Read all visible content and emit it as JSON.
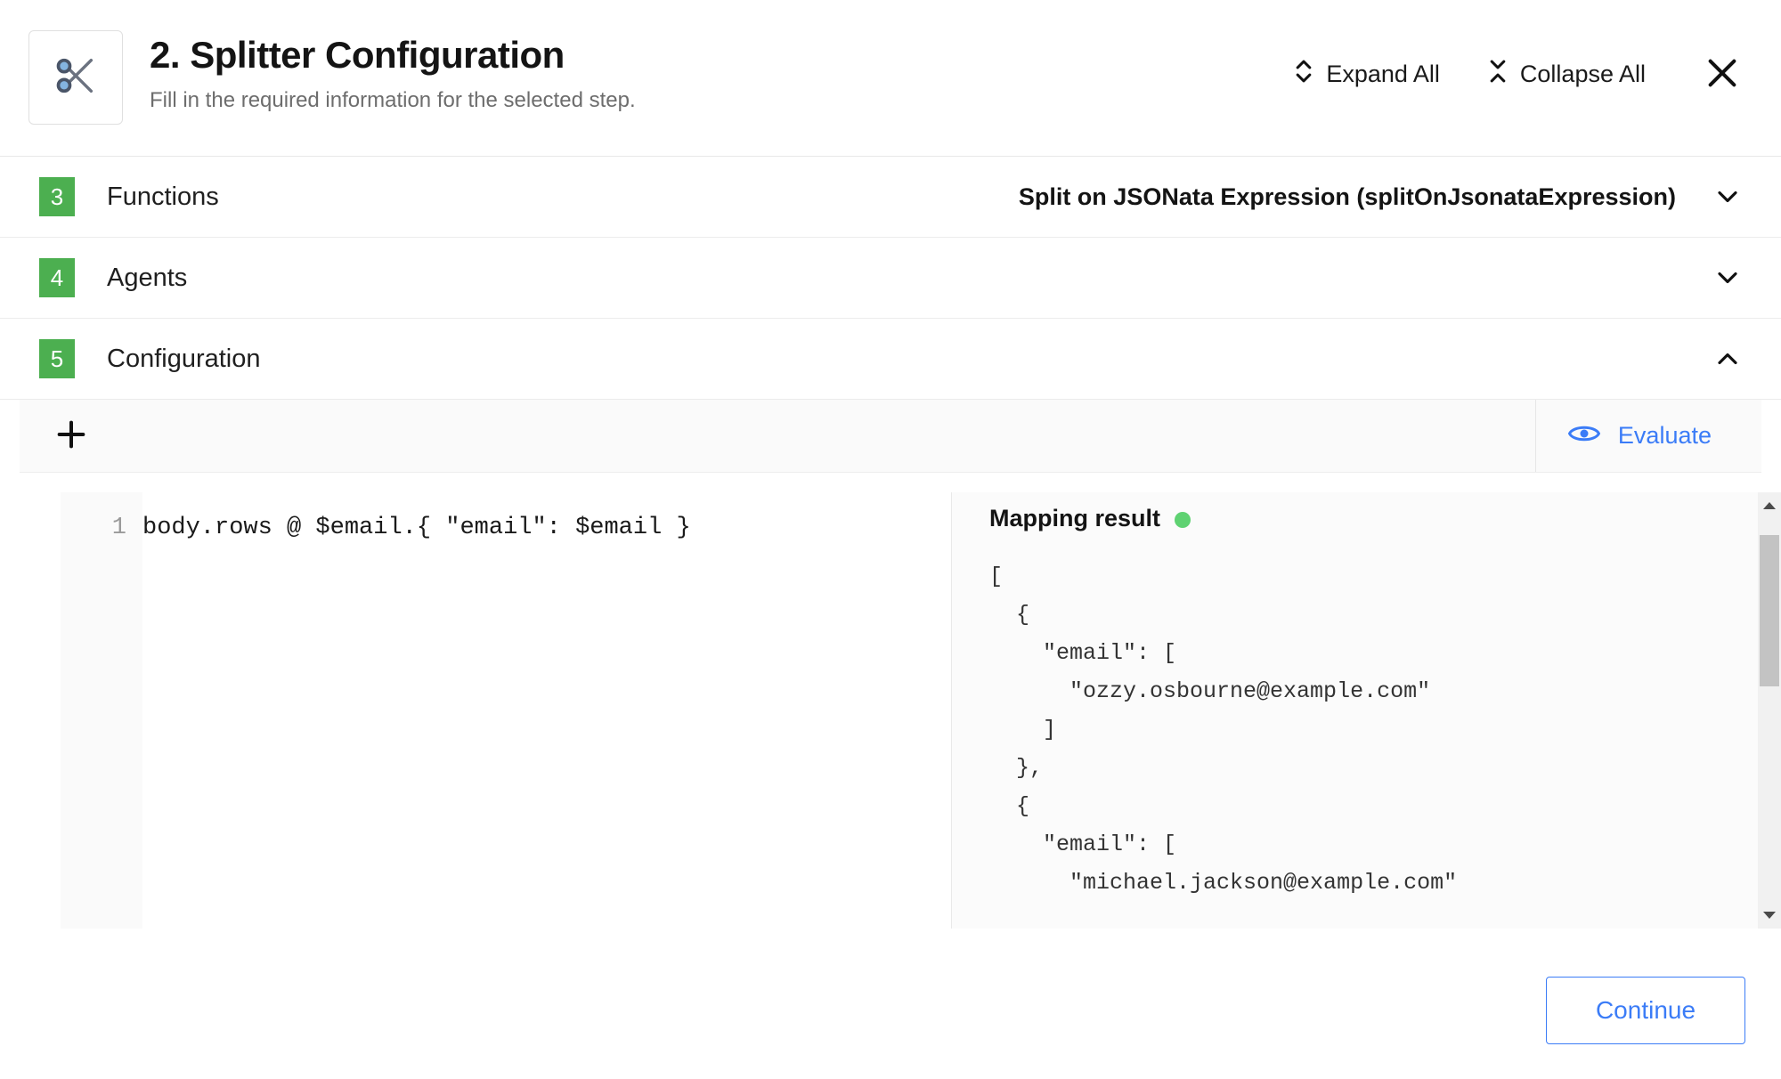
{
  "header": {
    "icon": "scissors-icon",
    "title": "2. Splitter Configuration",
    "subtitle": "Fill in the required information for the selected step.",
    "expand_all_label": "Expand All",
    "collapse_all_label": "Collapse All",
    "close_label": "✕"
  },
  "accordion": {
    "rows": [
      {
        "number": "3",
        "label": "Functions",
        "value": "Split on JSONata Expression (splitOnJsonataExpression)",
        "expanded": false,
        "chevron": "chevron-down-icon"
      },
      {
        "number": "4",
        "label": "Agents",
        "value": "",
        "expanded": false,
        "chevron": "chevron-down-icon"
      },
      {
        "number": "5",
        "label": "Configuration",
        "value": "",
        "expanded": true,
        "chevron": "chevron-up-icon"
      }
    ]
  },
  "config_toolbar": {
    "add_label": "+",
    "evaluate_label": "Evaluate",
    "evaluate_icon": "eye-icon"
  },
  "editor": {
    "line_number": "1",
    "code": "body.rows @ $email.{ \"email\": $email }"
  },
  "mapping_result": {
    "title": "Mapping result",
    "status_color": "#5fd272",
    "json": "[\n  {\n    \"email\": [\n      \"ozzy.osbourne@example.com\"\n    ]\n  },\n  {\n    \"email\": [\n      \"michael.jackson@example.com\"",
    "scroll_up_icon": "triangle-up-icon",
    "scroll_down_icon": "triangle-down-icon"
  },
  "footer": {
    "continue_label": "Continue"
  },
  "colors": {
    "badge_green": "#4caf50",
    "accent_blue": "#3b7cf7",
    "status_green": "#5fd272"
  }
}
